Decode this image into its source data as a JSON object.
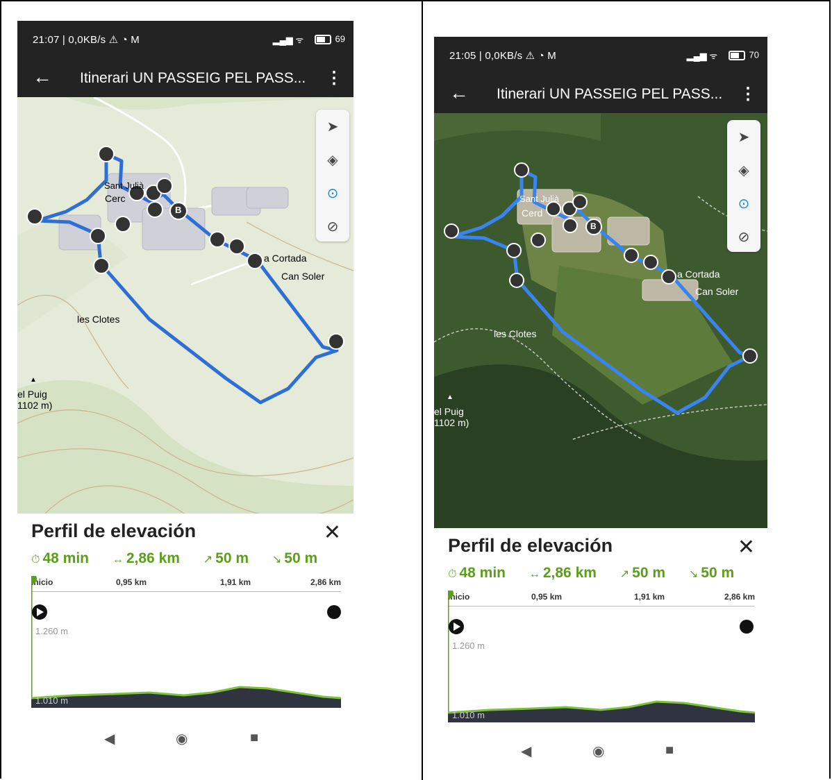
{
  "left": {
    "statusbar": {
      "time": "21:07 | 0,0KB/s ⚠ ◔ M",
      "battery": "69"
    },
    "appbar": {
      "title": "Itinerari UN PASSEIG PEL PASS...",
      "back_icon": "arrow-left-icon",
      "menu_icon": "more-vert-icon"
    },
    "map": {
      "labels": {
        "village": "Cerc",
        "village_top": "Sant Julià",
        "cortada": "a Cortada",
        "can_soler": "Can Soler",
        "clotes": "les Clotes",
        "puig": "el Puig",
        "puig_alt": "1102 m)"
      },
      "marker_b": "B"
    },
    "panel": {
      "title": "Perfil de elevación",
      "time": "48 min",
      "distance": "2,86 km",
      "ascent": "50 m",
      "descent": "50 m",
      "ticks": [
        "Inicio",
        "0,95 km",
        "1,91 km",
        "2,86 km"
      ],
      "elev_top": "1.260 m",
      "elev_bottom": "1.010 m"
    }
  },
  "right": {
    "statusbar": {
      "time": "21:05 | 0,0KB/s ⚠ ◔ M",
      "battery": "70"
    },
    "appbar": {
      "title": "Itinerari UN PASSEIG PEL PASS...",
      "back_icon": "arrow-left-icon",
      "menu_icon": "more-vert-icon"
    },
    "map": {
      "labels": {
        "village": "Cerd",
        "village_top": "Sant Julià",
        "cortada": "a Cortada",
        "can_soler": "Can Soler",
        "clotes": "les Clotes",
        "puig": "el Puig",
        "puig_alt": "1102 m)"
      },
      "marker_b": "B"
    },
    "panel": {
      "title": "Perfil de elevación",
      "time": "48 min",
      "distance": "2,86 km",
      "ascent": "50 m",
      "descent": "50 m",
      "ticks": [
        "Inicio",
        "0,95 km",
        "1,91 km",
        "2,86 km"
      ],
      "elev_top": "1.260 m",
      "elev_bottom": "1.010 m"
    }
  },
  "colors": {
    "route": "#2e6fd6",
    "accent_green": "#5a9e1a",
    "bar_dark": "#232323"
  }
}
